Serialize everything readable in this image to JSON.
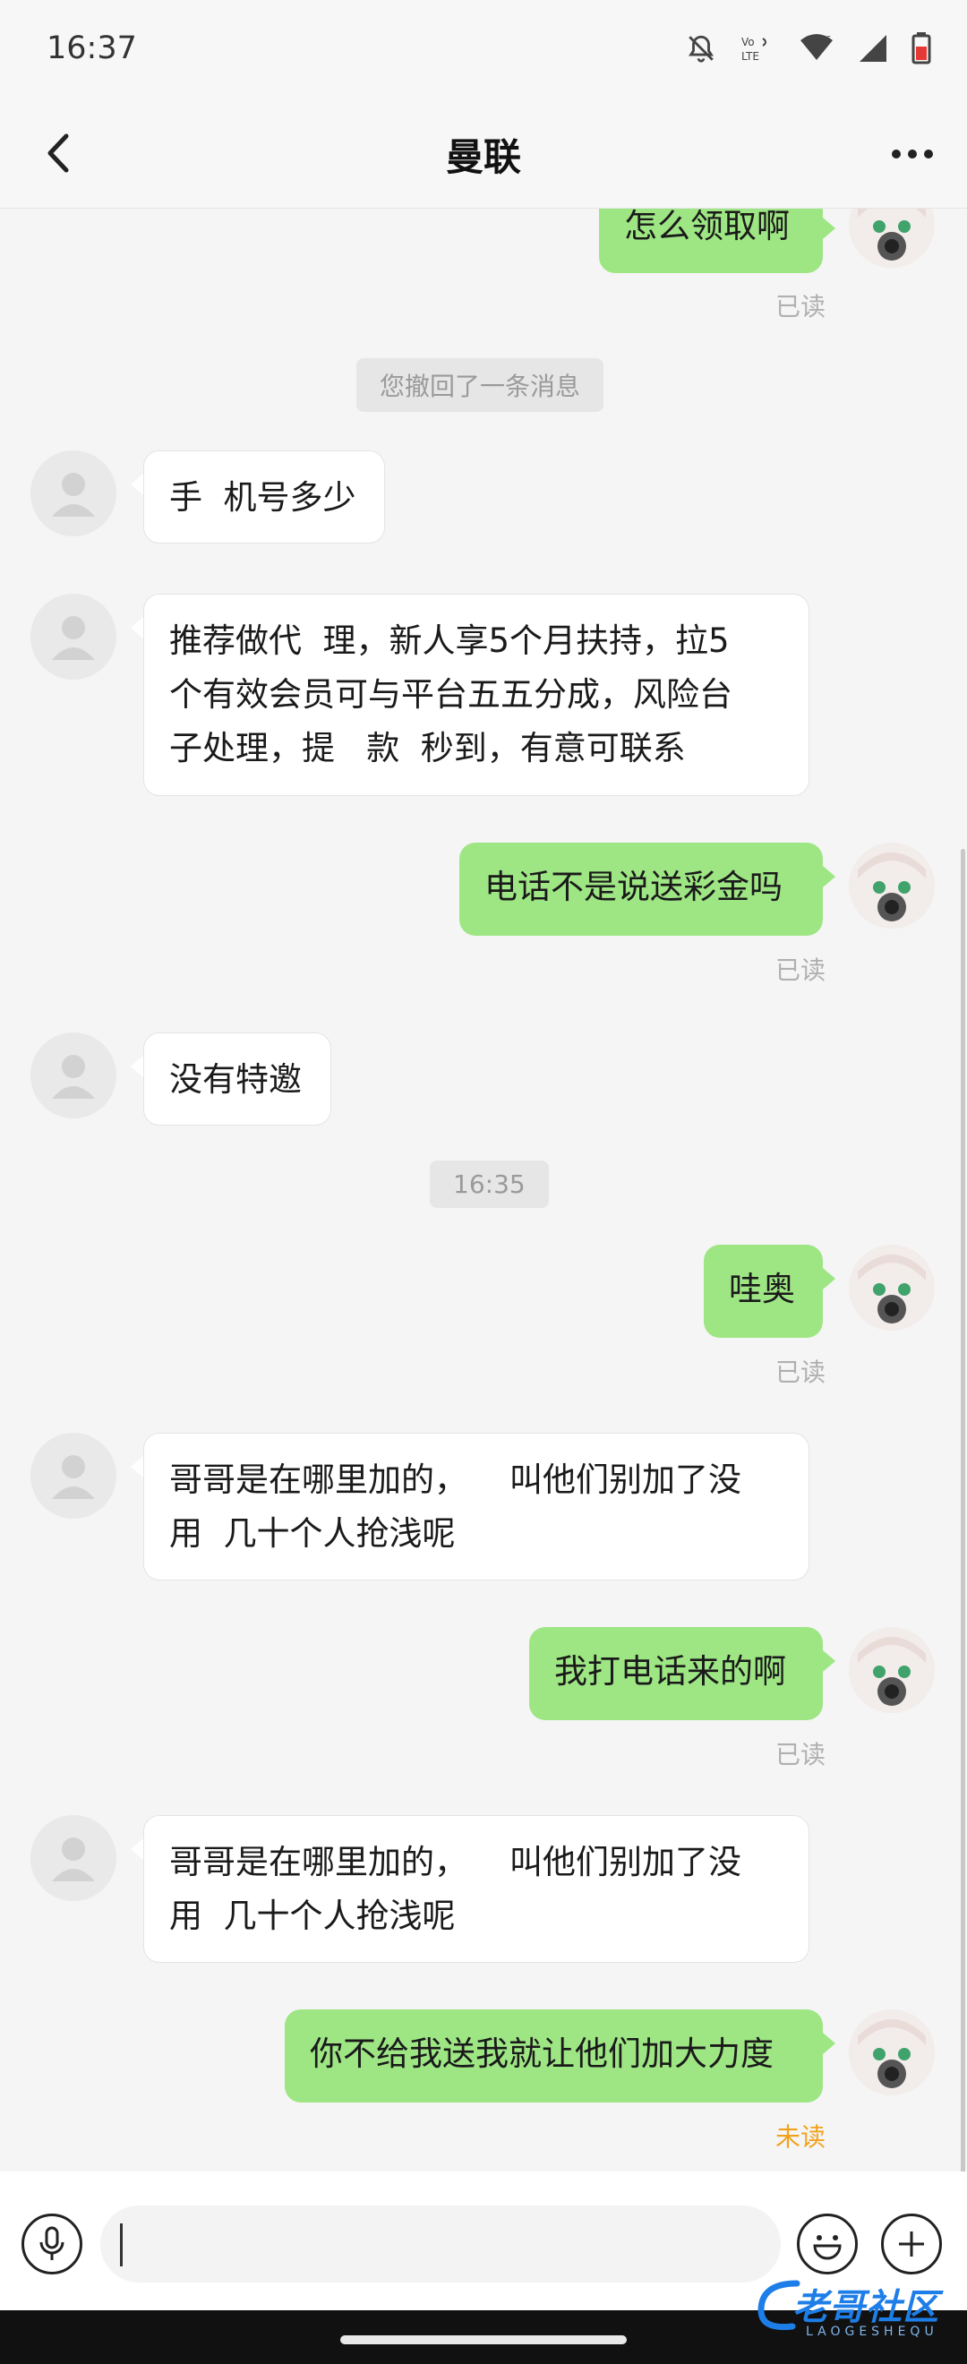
{
  "status_bar": {
    "time": "16:37"
  },
  "header": {
    "title": "曼联"
  },
  "messages": [
    {
      "side": "out",
      "text": "怎么领取啊",
      "status": "已读"
    },
    {
      "type": "notice",
      "text": "您撤回了一条消息"
    },
    {
      "side": "in",
      "text": "手  机号多少"
    },
    {
      "side": "in",
      "text": "推荐做代  理，新人享5个月扶持，拉5\n个有效会员可与平台五五分成，风险台\n子处理，提   款  秒到，有意可联系"
    },
    {
      "side": "out",
      "text": "电话不是说送彩金吗",
      "status": "已读"
    },
    {
      "side": "in",
      "text": "没有特邀"
    },
    {
      "type": "time",
      "text": "16:35"
    },
    {
      "side": "out",
      "text": "哇奥",
      "status": "已读"
    },
    {
      "side": "in",
      "text": "哥哥是在哪里加的，    叫他们别加了没\n用  几十个人抢浅呢"
    },
    {
      "side": "out",
      "text": "我打电话来的啊",
      "status": "已读"
    },
    {
      "side": "in",
      "text": "哥哥是在哪里加的，    叫他们别加了没\n用  几十个人抢浅呢"
    },
    {
      "side": "out",
      "text": "你不给我送我就让他们加大力度",
      "status": "未读"
    }
  ],
  "composer": {
    "value": ""
  },
  "watermark": {
    "text": "老哥社区",
    "sub": "LAOGESHEQU"
  },
  "colors": {
    "outgoing_bubble": "#9ee684",
    "incoming_bubble": "#ffffff",
    "unread_status": "#f1a21c",
    "read_status": "#b0b0b0"
  },
  "icons": [
    "bell-off-icon",
    "volte-icon",
    "wifi-icon",
    "signal-icon",
    "battery-icon",
    "back-arrow-icon",
    "more-dots-icon",
    "mic-icon",
    "emoji-icon",
    "plus-icon",
    "default-avatar-icon",
    "anime-avatar-icon"
  ]
}
